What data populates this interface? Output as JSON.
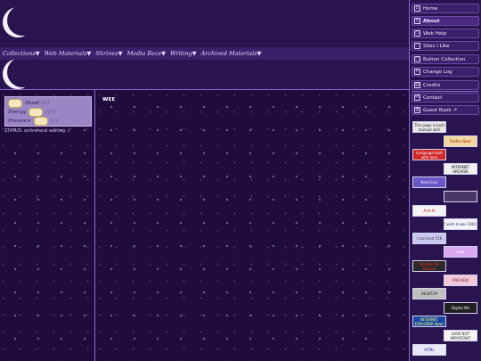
{
  "nav": {
    "items": [
      "Collections▼",
      "Web Materials▼",
      "Shrines▼",
      "Media Recs▼",
      "Writing▼",
      "Archived Materials▼"
    ]
  },
  "status": {
    "rows": [
      {
        "label": "Mood",
        "value": "/ / /"
      },
      {
        "label": "Energy",
        "value": "/ / / /"
      },
      {
        "label": "Presence",
        "value": "/ / /"
      }
    ],
    "text": "STATUS: online and waiting :)"
  },
  "main": {
    "title": "ᴡᴇᴇ"
  },
  "sidebar": {
    "items": [
      {
        "label": "Home",
        "icon": "house-icon",
        "glyph": "⌂",
        "active": false
      },
      {
        "label": "About",
        "icon": "pin-icon",
        "glyph": "⚲",
        "active": true
      },
      {
        "label": "Web Help",
        "icon": "screen-icon",
        "glyph": "▭",
        "active": false
      },
      {
        "label": "Sites I Like",
        "icon": "heart-icon",
        "glyph": "♡",
        "active": false
      },
      {
        "label": "Button Collection",
        "icon": "circle-icon",
        "glyph": "○",
        "active": false
      },
      {
        "label": "Change Log",
        "icon": "refresh-icon",
        "glyph": "↻",
        "active": false
      },
      {
        "label": "Credits",
        "icon": "document-icon",
        "glyph": "▤",
        "active": false
      },
      {
        "label": "Contact",
        "icon": "envelope-icon",
        "glyph": "✉",
        "active": false
      },
      {
        "label": "Guest Book ↗",
        "icon": "globe-icon",
        "glyph": "◍",
        "active": false
      }
    ]
  },
  "badges": [
    {
      "name": "hand-made-badge",
      "text": "This page is built manual with",
      "bg": "#e8e8e8",
      "fg": "#202020"
    },
    {
      "name": "firefox-badge",
      "text": "Firefox Now!",
      "bg": "#f0d8a0",
      "fg": "#b02000"
    },
    {
      "name": "language-badge",
      "text": "Language built with love",
      "bg": "#d02828",
      "fg": "#ffffff"
    },
    {
      "name": "internet-archive-badge",
      "text": "INTERNET ARCHIVE",
      "bg": "#f0f0f0",
      "fg": "#000000"
    },
    {
      "name": "neocities-badge",
      "text": "NeoCities",
      "bg": "#6a58c8",
      "fg": "#ffe0ff"
    },
    {
      "name": "anime-badge",
      "text": "",
      "bg": "#483868",
      "fg": "#ffffff"
    },
    {
      "name": "no-ai-badge",
      "text": "Anti AI",
      "bg": "#f4f4f4",
      "fg": "#c01010"
    },
    {
      "name": "wish-badge",
      "text": "I wish it was 2001",
      "bg": "#f4f4ff",
      "fg": "#303030"
    },
    {
      "name": "resolution-badge",
      "text": "I survived Y2K",
      "bg": "#c8c8f0",
      "fg": "#404040"
    },
    {
      "name": "pink-badge",
      "text": "look",
      "bg": "#d8a8f0",
      "fg": "#ffffff"
    },
    {
      "name": "no-nazi-badge",
      "text": "No Nazi No Racism",
      "bg": "#2a2a2a",
      "fg": "#ff3030"
    },
    {
      "name": "preview-badge",
      "text": "PREVIEW",
      "bg": "#f0c8d8",
      "fg": "#802040"
    },
    {
      "name": "best-viewed-badge",
      "text": "DESKTOP",
      "bg": "#c0c0c0",
      "fg": "#202020"
    },
    {
      "name": "digital-badge",
      "text": "Digital Me",
      "bg": "#202020",
      "fg": "#ffffff"
    },
    {
      "name": "explorer-badge",
      "text": "INTERNET EXPLORER Now!",
      "bg": "#1848a8",
      "fg": "#ffff60"
    },
    {
      "name": "save-badge",
      "text": "SAVE NOT IMPORTANT",
      "bg": "#f4f4f4",
      "fg": "#303030"
    },
    {
      "name": "html-badge",
      "text": "HTML",
      "bg": "#e8e8f8",
      "fg": "#2020a0"
    }
  ]
}
